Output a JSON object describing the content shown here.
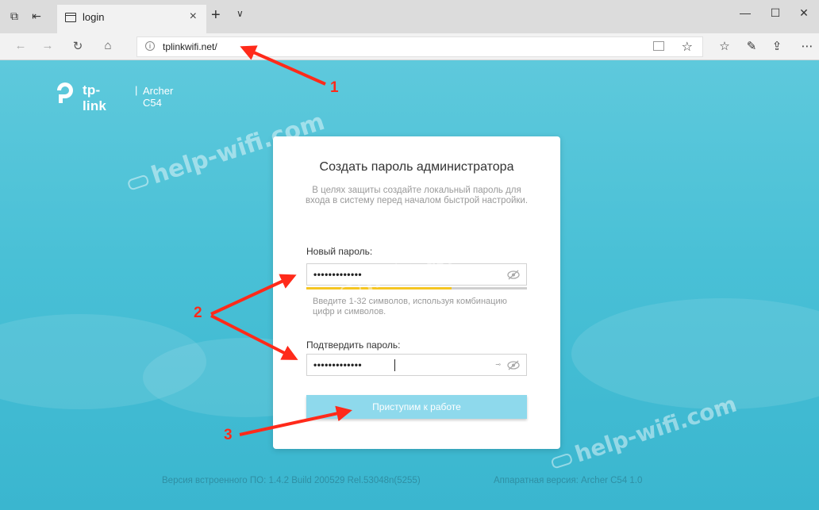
{
  "browser": {
    "tab_title": "login",
    "tab_close": "×",
    "new_tab": "+",
    "tab_list": "∨",
    "url": "tplinkwifi.net/",
    "minimize": "—",
    "maximize": "☐",
    "close": "✕"
  },
  "brand": {
    "name": "tp-link",
    "separator": "|",
    "model": "Archer C54",
    "color": "#ffffff"
  },
  "card": {
    "title": "Создать пароль администратора",
    "subtitle": "В целях защиты создайте локальный пароль для входа в систему перед началом быстрой настройки.",
    "new_password_label": "Новый пароль:",
    "new_password_value": "•••••••••••••",
    "strength_fraction": 0.66,
    "hint": "Введите 1-32 символов, используя комбинацию цифр и символов.",
    "confirm_password_label": "Подтвердить пароль:",
    "confirm_password_value": "•••••••••••••",
    "submit_label": "Приступим к работе"
  },
  "footer": {
    "firmware": "Версия встроенного ПО: 1.4.2 Build 200529 Rel.53048n(5255)",
    "hardware": "Аппаратная версия: Archer C54 1.0"
  },
  "watermark": {
    "text": "help-wifi.com"
  },
  "annotations": {
    "label_1": "1",
    "label_2": "2",
    "label_3": "3",
    "color": "#ff2a1a"
  },
  "colors": {
    "page_background": "#49c0d6",
    "button": "#8ed9ec",
    "strength_bar": "#f5c523"
  }
}
